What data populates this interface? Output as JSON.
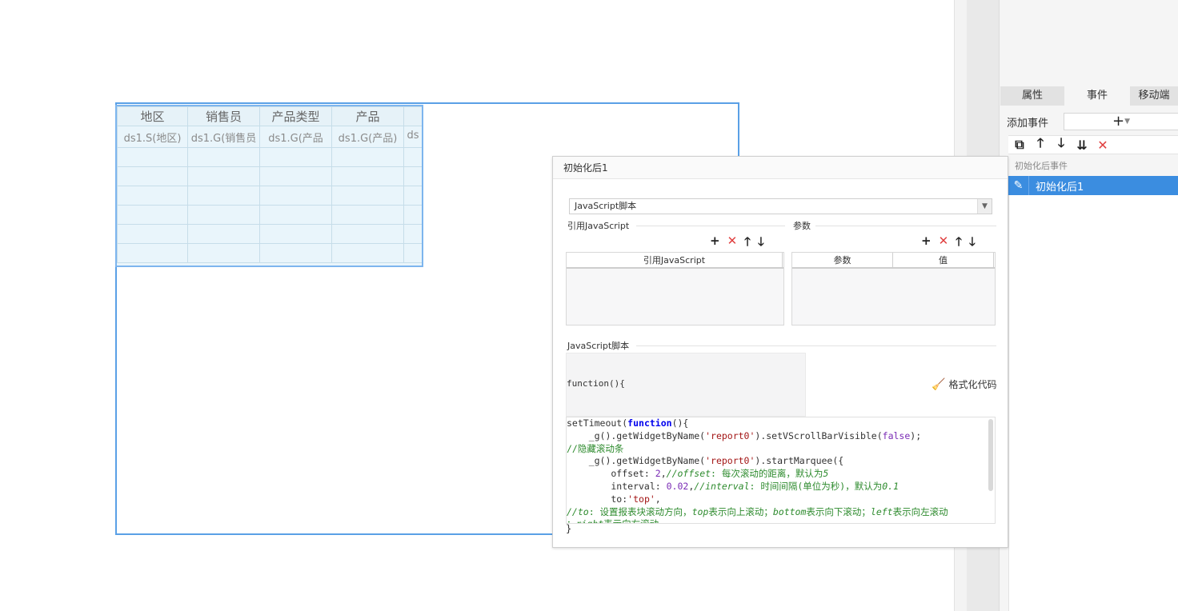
{
  "report_table": {
    "headers": [
      "地区",
      "销售员",
      "产品类型",
      "产品",
      ""
    ],
    "bindings": [
      "ds1.S(地区)",
      "ds1.G(销售员",
      "ds1.G(产品",
      "ds1.G(产品)",
      "ds"
    ]
  },
  "side_panel": {
    "tabs": [
      "属性",
      "事件",
      "移动端"
    ],
    "add_event_label": "添加事件",
    "add_event_button": "+",
    "event_group_label": "初始化后事件",
    "event_item": "初始化后1"
  },
  "dialog": {
    "title": "初始化后1",
    "type_select": "JavaScript脚本",
    "ref_js_section": "引用JavaScript",
    "ref_js_column": "引用JavaScript",
    "params_section": "参数",
    "params_columns": [
      "参数",
      "值"
    ],
    "script_section": "JavaScript脚本",
    "fn_header": "function(){",
    "format_button": "格式化代码",
    "fn_close": "}"
  },
  "colors": {
    "selection_blue": "#3b8de0",
    "frame_border": "#5aa0e6",
    "delete_red": "#e04040"
  }
}
